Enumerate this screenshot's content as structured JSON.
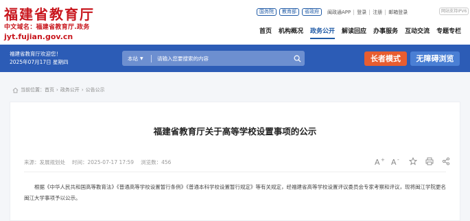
{
  "header": {
    "site_title": "福建省教育厅",
    "domain_cn": "中文域名：福建省教育厅.政务",
    "domain": "jyt.fujian.gov.cn",
    "tag_links": [
      "国务院",
      "教育部",
      "省政府"
    ],
    "top_links": [
      "闽政通APP",
      "登录",
      "注册",
      "邮箱登录"
    ],
    "ipv6_badge": "网站支持IPV6",
    "nav": [
      "首页",
      "机构概况",
      "政务公开",
      "解读回应",
      "办事服务",
      "互动交流",
      "专题专栏"
    ],
    "active_nav_index": 2
  },
  "banner": {
    "welcome": "福建省教育厅欢迎您！",
    "date": "2025年07月17日 星期四",
    "search_scope": "本站",
    "search_placeholder": "请输入您要搜索的内容",
    "elder_mode": "长者模式",
    "accessible": "无障碍浏览"
  },
  "breadcrumb": {
    "label": "当前位置：",
    "items": [
      "首页",
      "政务公开",
      "公告公示"
    ]
  },
  "article": {
    "title": "福建省教育厅关于高等学校设置事项的公示",
    "source": "来源：发展规划处",
    "time": "时间：2025-07-17 17:59",
    "views": "浏览数：456",
    "body": "根据《中华人民共和国高等教育法》《普通高等学校设置暂行条例》《普通本科学校设置暂行规定》等有关规定，经福建省高等学校设置评议委员会专家考察和评议，现将闽江学院更名闽江大学事项予以公示。"
  },
  "colors": {
    "brand_red": "#c8161d",
    "banner_blue": "#2c5cb6",
    "elder_orange": "#e85d30",
    "access_blue": "#4a7fd4"
  },
  "icons": [
    "home-icon",
    "search-icon",
    "font-increase-icon",
    "font-decrease-icon",
    "star-icon",
    "print-icon",
    "share-icon",
    "chevron-down-icon"
  ]
}
